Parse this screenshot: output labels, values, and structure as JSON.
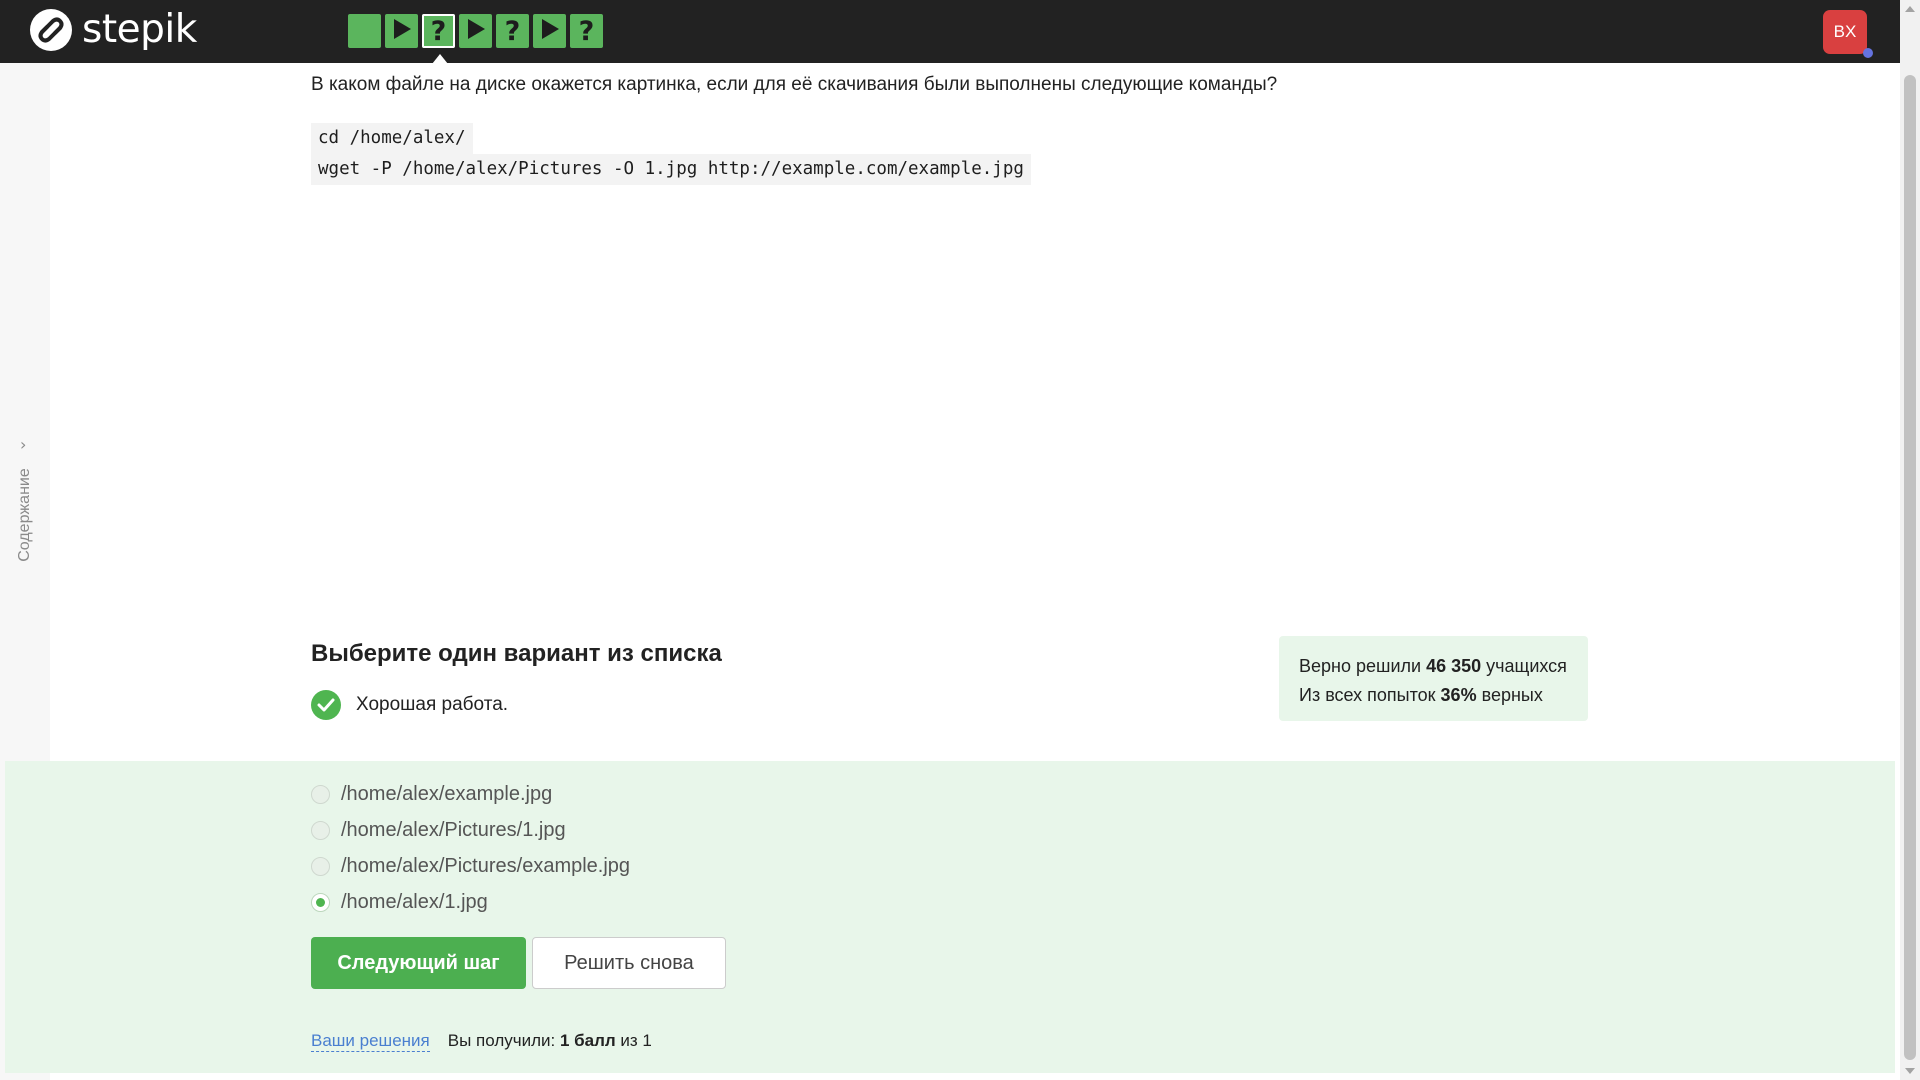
{
  "header": {
    "logo_text": "stepik",
    "steps": [
      {
        "type": "text",
        "glyph": ""
      },
      {
        "type": "video",
        "glyph": ""
      },
      {
        "type": "quiz",
        "glyph": "?",
        "current": true
      },
      {
        "type": "video",
        "glyph": ""
      },
      {
        "type": "quiz",
        "glyph": "?"
      },
      {
        "type": "video",
        "glyph": ""
      },
      {
        "type": "quiz",
        "glyph": "?"
      }
    ],
    "avatar_initials": "BX"
  },
  "sidebar": {
    "toc_label": "Содержание"
  },
  "step": {
    "question": "В каком файле на диске окажется картинка, если для её скачивания были выполнены следующие команды?",
    "code_lines": [
      "cd /home/alex/",
      "wget -P /home/alex/Pictures -O 1.jpg http://example.com/example.jpg"
    ],
    "task_title": "Выберите один вариант из списка",
    "feedback": "Хорошая работа."
  },
  "stats": {
    "line1_prefix": "Верно решили ",
    "line1_value": "46 350",
    "line1_suffix": " учащихся",
    "line2_prefix": "Из всех попыток ",
    "line2_value": "36%",
    "line2_suffix": " верных"
  },
  "options": [
    {
      "label": "/home/alex/example.jpg",
      "checked": false
    },
    {
      "label": "/home/alex/Pictures/1.jpg",
      "checked": false
    },
    {
      "label": "/home/alex/Pictures/example.jpg",
      "checked": false
    },
    {
      "label": "/home/alex/1.jpg",
      "checked": true
    }
  ],
  "buttons": {
    "next": "Следующий шаг",
    "retry": "Решить снова"
  },
  "footer": {
    "solutions_link": "Ваши решения",
    "score_prefix": "Вы получили: ",
    "score_value": "1 балл",
    "score_suffix": " из 1"
  },
  "colors": {
    "brand_green": "#5bb55d",
    "success_bg": "#e8f6ea",
    "avatar_red": "#d94040",
    "link_blue": "#4a7fd0"
  }
}
